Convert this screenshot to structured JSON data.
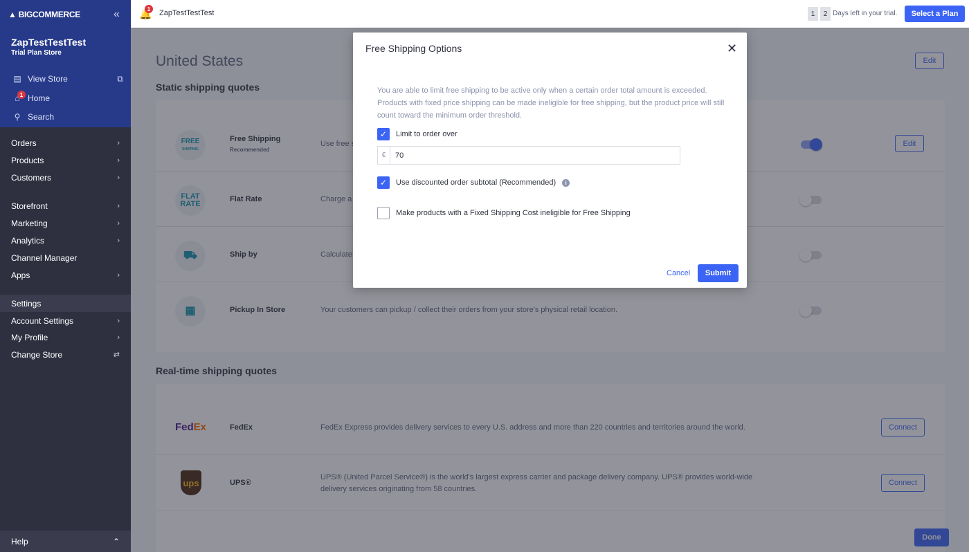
{
  "brand": {
    "logo": "BIGCOMMERCE",
    "store_name": "ZapTestTestTest",
    "plan": "Trial Plan Store"
  },
  "sidebar": {
    "links": [
      {
        "label": "View Store",
        "icon": "storefront-icon"
      },
      {
        "label": "Home",
        "icon": "home-icon",
        "badge": "1"
      },
      {
        "label": "Search",
        "icon": "search-icon"
      }
    ],
    "items": [
      {
        "label": "Orders"
      },
      {
        "label": "Products"
      },
      {
        "label": "Customers"
      },
      {
        "label": "Storefront"
      },
      {
        "label": "Marketing"
      },
      {
        "label": "Analytics"
      },
      {
        "label": "Channel Manager"
      },
      {
        "label": "Apps"
      },
      {
        "label": "Settings"
      },
      {
        "label": "Account Settings"
      },
      {
        "label": "My Profile"
      },
      {
        "label": "Change Store"
      }
    ],
    "help": "Help"
  },
  "topbar": {
    "notification_count": "1",
    "store_name": "ZapTestTestTest",
    "days": [
      "1",
      "2"
    ],
    "trial_text": "Days left in your trial.",
    "select_plan": "Select a Plan"
  },
  "main": {
    "title": "United States",
    "edit": "Edit",
    "static_heading": "Static shipping quotes",
    "static": [
      {
        "name": "Free Shipping",
        "sub": "Recommended",
        "desc": "Use free shipping",
        "icon_text": [
          "FREE",
          "SHIPPING"
        ],
        "enabled": true,
        "action": "Edit"
      },
      {
        "name": "Flat Rate",
        "desc": "Charge a flat rate",
        "icon_text": [
          "FLAT",
          "RATE"
        ],
        "enabled": false
      },
      {
        "name": "Ship by",
        "desc": "Calculate shipping",
        "enabled": false
      },
      {
        "name": "Pickup In Store",
        "desc": "Your customers can pickup / collect their orders from your store's physical retail location.",
        "enabled": false
      }
    ],
    "realtime_heading": "Real-time shipping quotes",
    "realtime": [
      {
        "name": "FedEx",
        "logo": "FedEx",
        "desc": "FedEx Express provides delivery services to every U.S. address and more than 220 countries and territories around the world.",
        "action": "Connect"
      },
      {
        "name": "UPS®",
        "logo": "ups",
        "desc": "UPS® (United Parcel Service®) is the world's largest express carrier and package delivery company. UPS® provides world-wide delivery services originating from 58 countries.",
        "action": "Connect"
      }
    ],
    "done": "Done"
  },
  "modal": {
    "title": "Free Shipping Options",
    "description": "You are able to limit free shipping to be active only when a certain order total amount is exceeded. Products with fixed price shipping can be made ineligible for free shipping, but the product price will still count toward the minimum order threshold.",
    "limit_label": "Limit to order over",
    "limit_checked": true,
    "currency": "€",
    "amount": "70",
    "discounted_label": "Use discounted order subtotal (Recommended)",
    "discounted_checked": true,
    "fixed_label": "Make products with a Fixed Shipping Cost ineligible for Free Shipping",
    "fixed_checked": false,
    "cancel": "Cancel",
    "submit": "Submit"
  },
  "colors": {
    "primary": "#3c64f4",
    "sidebar_top": "#273a8a",
    "sidebar": "#2e3040",
    "badge": "#db3643"
  }
}
